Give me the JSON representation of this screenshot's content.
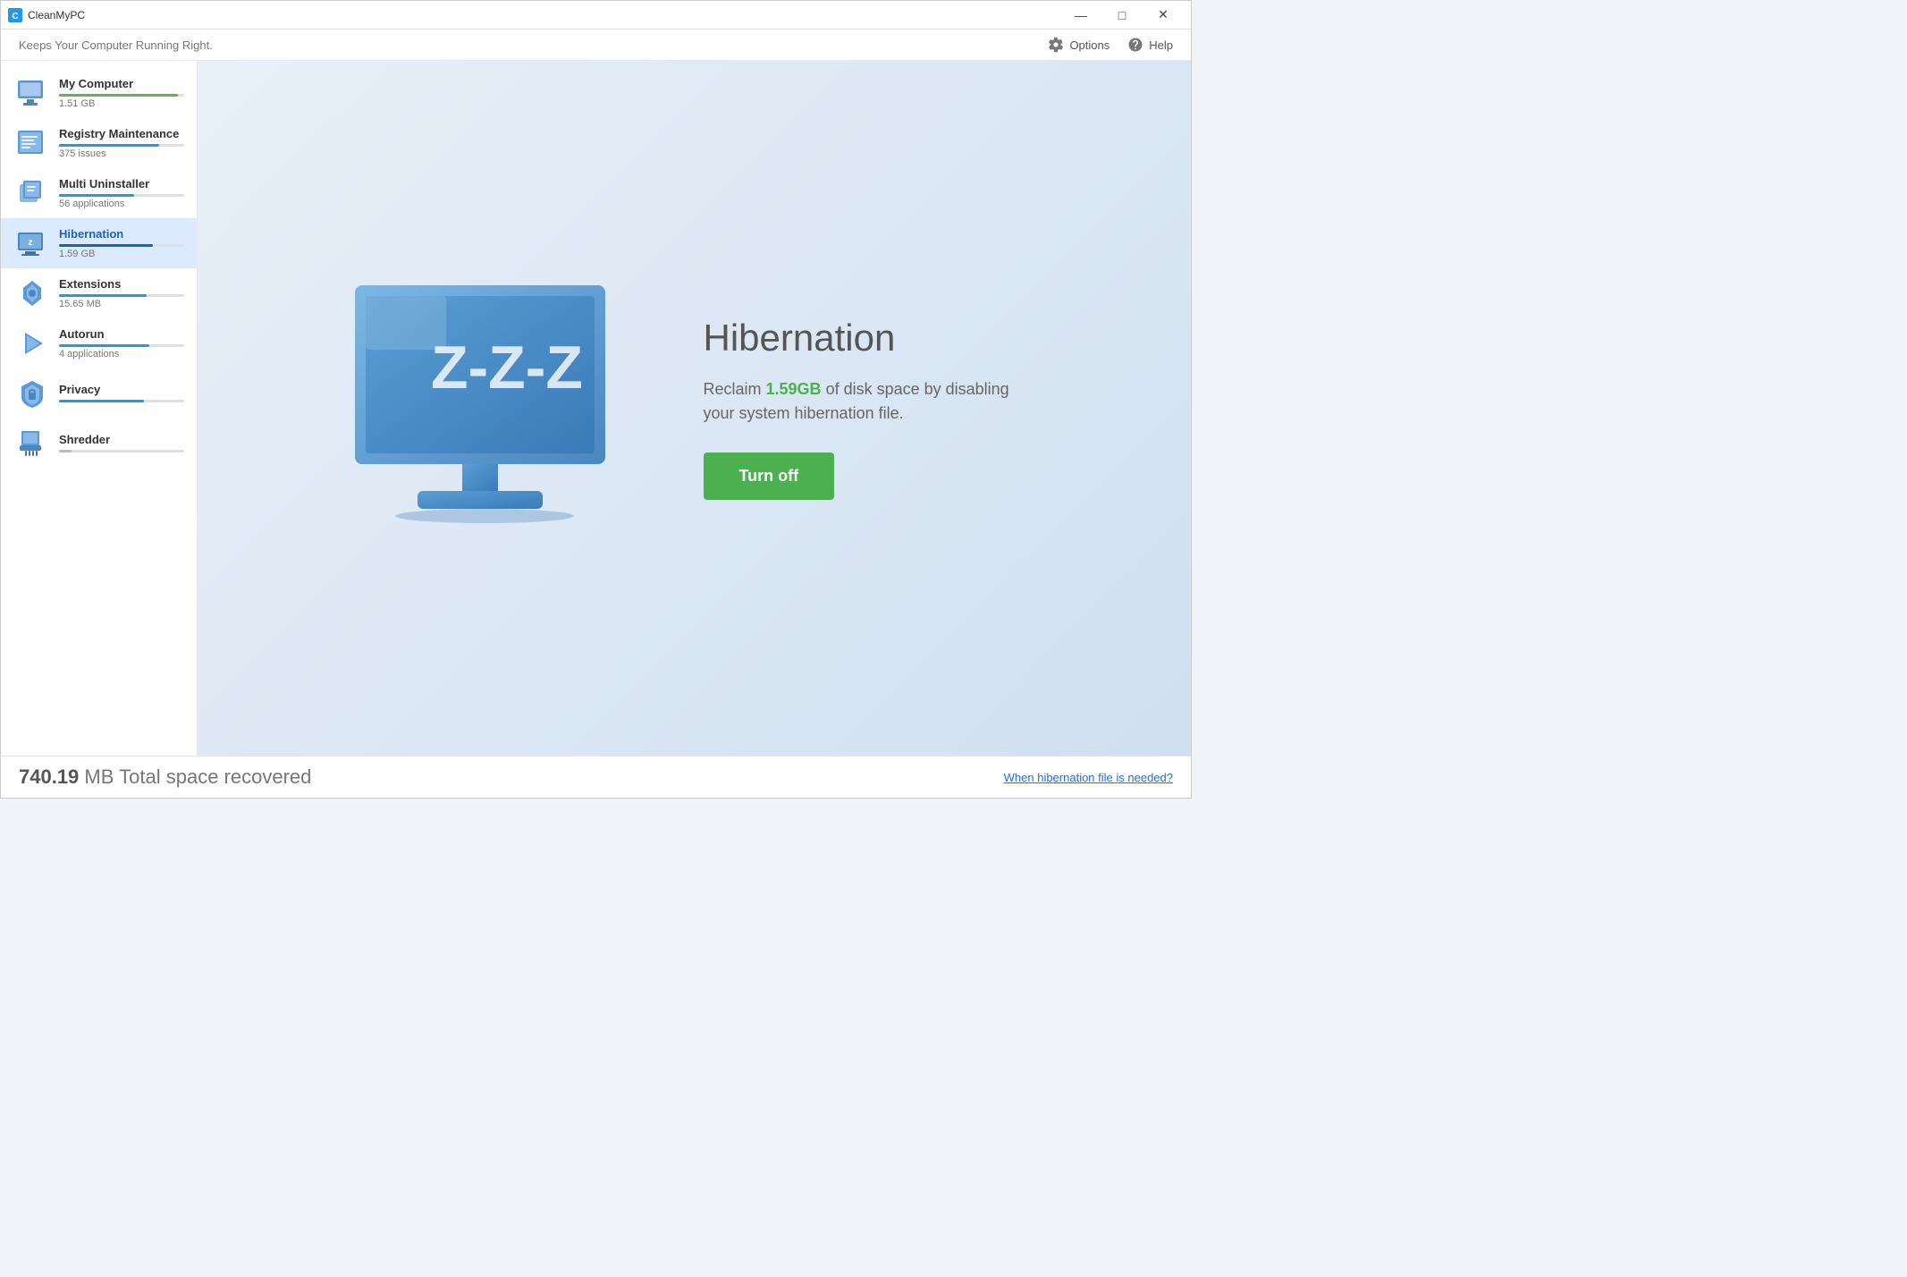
{
  "titleBar": {
    "appName": "CleanMyPC",
    "controls": {
      "minimize": "—",
      "maximize": "□",
      "close": "✕"
    }
  },
  "header": {
    "tagline": "Keeps Your Computer Running Right.",
    "options_label": "Options",
    "help_label": "Help"
  },
  "sidebar": {
    "items": [
      {
        "id": "my-computer",
        "label": "My Computer",
        "sub": "1.51 GB",
        "bar_width": "95",
        "bar_color": "#6ab04c",
        "active": false
      },
      {
        "id": "registry-maintenance",
        "label": "Registry Maintenance",
        "sub": "375 issues",
        "bar_width": "80",
        "bar_color": "#2196f3",
        "active": false
      },
      {
        "id": "multi-uninstaller",
        "label": "Multi Uninstaller",
        "sub": "56 applications",
        "bar_width": "60",
        "bar_color": "#2196f3",
        "active": false
      },
      {
        "id": "hibernation",
        "label": "Hibernation",
        "sub": "1.59 GB",
        "bar_width": "75",
        "bar_color": "#2196f3",
        "active": true
      },
      {
        "id": "extensions",
        "label": "Extensions",
        "sub": "15.65 MB",
        "bar_width": "70",
        "bar_color": "#2196f3",
        "active": false
      },
      {
        "id": "autorun",
        "label": "Autorun",
        "sub": "4 applications",
        "bar_width": "72",
        "bar_color": "#2196f3",
        "active": false
      },
      {
        "id": "privacy",
        "label": "Privacy",
        "sub": "",
        "bar_width": "68",
        "bar_color": "#2196f3",
        "active": false
      },
      {
        "id": "shredder",
        "label": "Shredder",
        "sub": "",
        "bar_width": "10",
        "bar_color": "#bbb",
        "active": false
      }
    ]
  },
  "content": {
    "title": "Hibernation",
    "description_prefix": "Reclaim ",
    "description_highlight": "1.59GB",
    "description_suffix": " of disk space by disabling your system hibernation file.",
    "button_label": "Turn off"
  },
  "footer": {
    "total_label": "MB Total space recovered",
    "total_prefix": "740.19",
    "link_label": "When hibernation file is needed?"
  }
}
